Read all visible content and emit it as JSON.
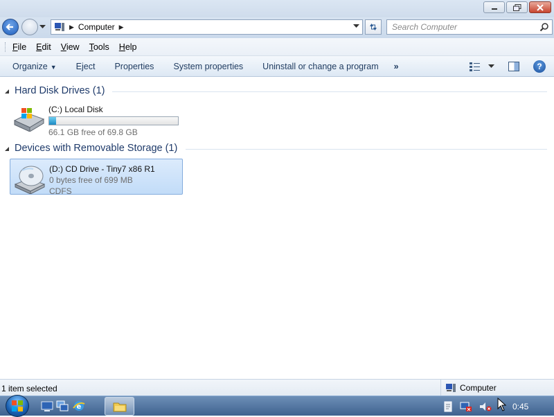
{
  "window": {
    "address": {
      "crumb": "Computer"
    },
    "search": {
      "placeholder": "Search Computer"
    }
  },
  "menubar": {
    "items": [
      {
        "underline": "F",
        "rest": "ile"
      },
      {
        "underline": "E",
        "rest": "dit"
      },
      {
        "underline": "V",
        "rest": "iew"
      },
      {
        "underline": "T",
        "rest": "ools"
      },
      {
        "underline": "H",
        "rest": "elp"
      }
    ]
  },
  "commandbar": {
    "organize": "Organize",
    "eject": "Eject",
    "properties": "Properties",
    "system_properties": "System properties",
    "uninstall": "Uninstall or change a program",
    "more": "»"
  },
  "groups": [
    {
      "title": "Hard Disk Drives (1)"
    },
    {
      "title": "Devices with Removable Storage (1)"
    }
  ],
  "drives": [
    {
      "name": "(C:) Local Disk",
      "free_text": "66.1 GB free of 69.8 GB",
      "used_fraction": 0.053
    },
    {
      "name": "(D:) CD Drive - Tiny7 x86 R1",
      "free_text": "0 bytes free of 699 MB",
      "filesystem": "CDFS"
    }
  ],
  "statusbar": {
    "selection": "1 item selected",
    "location": "Computer"
  },
  "taskbar": {
    "clock": "0:45"
  },
  "colors": {
    "accent": "#1e3a6a",
    "selection_bg": "#c2dcf8",
    "drive_bar_fill": "#1d8bc4"
  }
}
